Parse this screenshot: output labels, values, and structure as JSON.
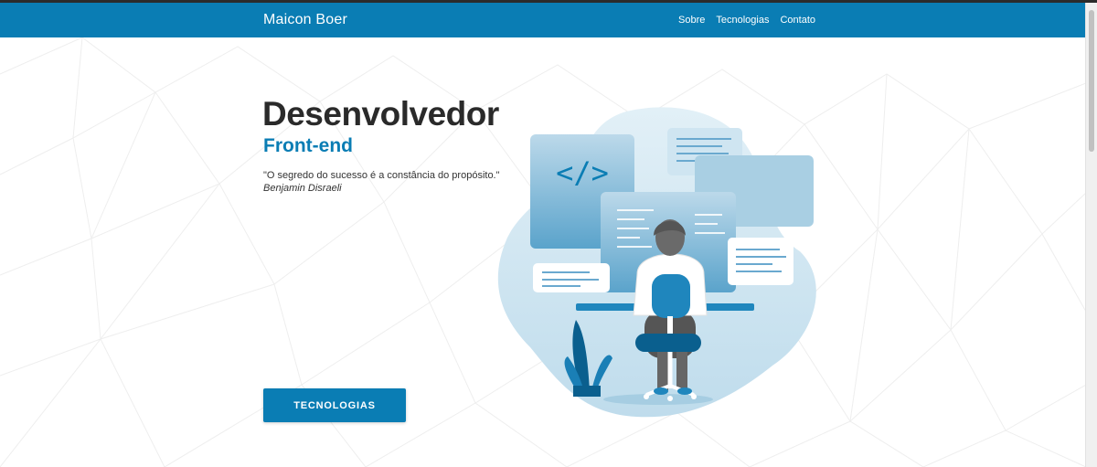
{
  "navbar": {
    "brand": "Maicon Boer",
    "links": [
      "Sobre",
      "Tecnologias",
      "Contato"
    ]
  },
  "hero": {
    "title": "Desenvolvedor",
    "subtitle": "Front-end",
    "quote": "\"O segredo do sucesso é a constância do propósito.\"",
    "quote_author": "Benjamin Disraeli",
    "cta_label": "TECNOLOGIAS"
  },
  "illustration": {
    "code_symbol": "</>"
  },
  "colors": {
    "primary": "#0a7db4",
    "title": "#2a2a2a",
    "light_blue": "#cfe5f1"
  }
}
